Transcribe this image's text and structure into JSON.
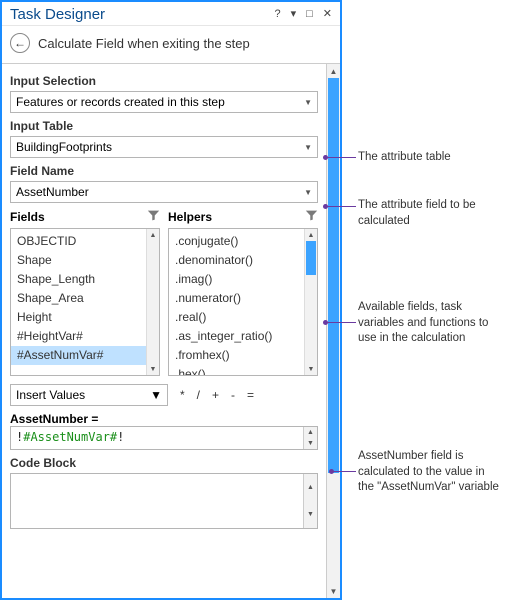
{
  "titlebar": {
    "title": "Task Designer"
  },
  "header": {
    "subtitle": "Calculate Field when exiting the step"
  },
  "form": {
    "input_selection_label": "Input Selection",
    "input_selection_value": "Features or records created in this step",
    "input_table_label": "Input Table",
    "input_table_value": "BuildingFootprints",
    "field_name_label": "Field Name",
    "field_name_value": "AssetNumber"
  },
  "fields": {
    "header": "Fields",
    "items": [
      "OBJECTID",
      "Shape",
      "Shape_Length",
      "Shape_Area",
      "Height",
      "#HeightVar#",
      "#AssetNumVar#"
    ],
    "selected_index": 6
  },
  "helpers": {
    "header": "Helpers",
    "items": [
      ".conjugate()",
      ".denominator()",
      ".imag()",
      ".numerator()",
      ".real()",
      ".as_integer_ratio()",
      ".fromhex()",
      ".hex()"
    ]
  },
  "ops": {
    "insert_label": "Insert Values",
    "operators": [
      "*",
      "/",
      "+",
      "-",
      "="
    ]
  },
  "expression": {
    "label": "AssetNumber =",
    "value_display": "!#AssetNumVar#!"
  },
  "codeblock": {
    "label": "Code Block"
  },
  "annotations": {
    "a1": "The attribute table",
    "a2": "The attribute field to be calculated",
    "a3": "Available fields, task variables and functions to use in the calculation",
    "a4": "AssetNumber field is calculated to the value in the \"AssetNumVar\" variable"
  }
}
